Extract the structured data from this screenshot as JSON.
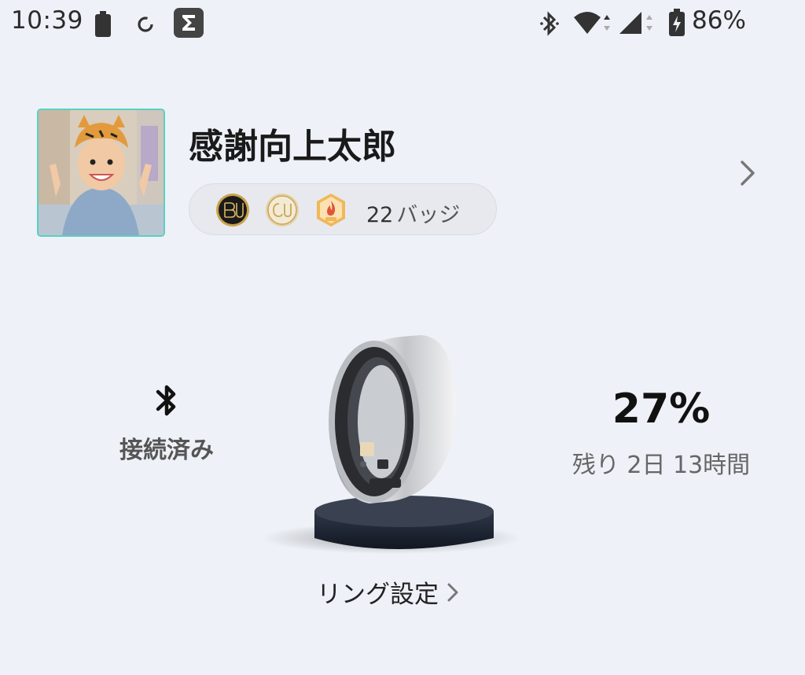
{
  "status_bar": {
    "time": "10:39",
    "battery_percent": "86%",
    "icons": [
      "battery-saver-icon",
      "sync-icon",
      "sigma-app-icon",
      "bluetooth-icon",
      "wifi-icon",
      "cellular-signal-icon",
      "battery-charging-icon"
    ]
  },
  "profile": {
    "name": "感謝向上太郎",
    "badge_count": "22",
    "badge_unit": "バッジ",
    "badges": [
      "bu-badge-icon",
      "gold-badge-icon",
      "lv-flame-badge-icon"
    ]
  },
  "ring": {
    "connection_status": "接続済み",
    "battery_percent": "27%",
    "remaining_time": "残り 2日 13時間",
    "settings_label": "リング設定"
  },
  "colors": {
    "background": "#eef1f7",
    "avatar_border": "#5ad0c0",
    "badge_pill": "#e7e9ee",
    "primary_text": "#1c1c1e",
    "secondary_text": "#666666"
  }
}
